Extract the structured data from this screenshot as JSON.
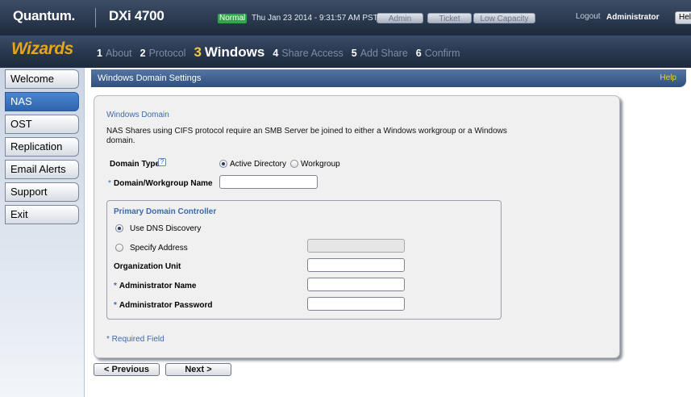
{
  "header": {
    "logo": "Quantum.",
    "model": "DXi 4700",
    "status": "Normal",
    "datetime": "Thu Jan 23 2014 - 9:31:57 AM PST",
    "pills": {
      "admin": "Admin",
      "ticket": "Ticket",
      "low_capacity": "Low Capacity"
    },
    "logout": "Logout",
    "user": "Administrator",
    "help": "Help"
  },
  "wizard": {
    "title": "Wizards",
    "steps": [
      {
        "n": "1",
        "label": "About"
      },
      {
        "n": "2",
        "label": "Protocol"
      },
      {
        "n": "3",
        "label": "Windows"
      },
      {
        "n": "4",
        "label": "Share Access"
      },
      {
        "n": "5",
        "label": "Add Share"
      },
      {
        "n": "6",
        "label": "Confirm"
      }
    ],
    "current_step": 3
  },
  "sidebar": {
    "items": [
      {
        "label": "Welcome"
      },
      {
        "label": "NAS"
      },
      {
        "label": "OST"
      },
      {
        "label": "Replication"
      },
      {
        "label": "Email Alerts"
      },
      {
        "label": "Support"
      },
      {
        "label": "Exit"
      }
    ],
    "active": "NAS"
  },
  "section": {
    "title": "Windows Domain Settings",
    "help": "Help"
  },
  "form": {
    "domain_heading": "Windows Domain",
    "intro": "NAS Shares using CIFS protocol require an SMB Server be joined to either a Windows workgroup or a Windows domain.",
    "domain_type_label": "Domain Type",
    "help_glyph": "?",
    "domain_type_options": [
      "Active Directory",
      "Workgroup"
    ],
    "domain_type_selected": "Active Directory",
    "required_mark": "*",
    "domain_name_label": "Domain/Workgroup Name",
    "domain_name_value": "",
    "pdc": {
      "title": "Primary Domain Controller",
      "use_dns": "Use DNS Discovery",
      "specify_address": "Specify Address",
      "selected": "Use DNS Discovery",
      "address_value": "",
      "org_unit_label": "Organization Unit",
      "org_unit_value": "",
      "admin_name_label": "Administrator Name",
      "admin_name_value": "",
      "admin_password_label": "Administrator Password",
      "admin_password_value": ""
    },
    "required_note": "* Required Field"
  },
  "buttons": {
    "previous": "< Previous",
    "next": "Next >"
  },
  "colors": {
    "accent": "#3d6aa8",
    "wizard_title": "#e6a51b",
    "status_ok": "#2ca844",
    "nav_active": "#2e64ac"
  }
}
